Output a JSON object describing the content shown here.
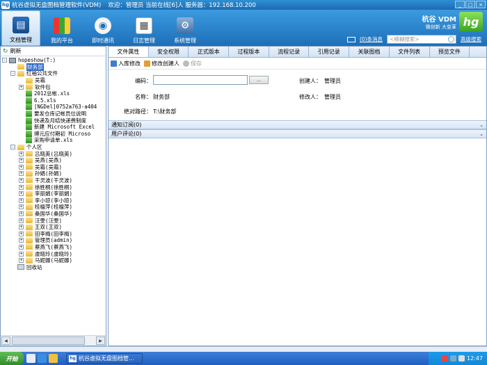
{
  "window": {
    "title": "杭谷虚拟无盘图档管理软件(VDM)",
    "welcome": "欢迎：管理员 当前在线[6]人 服务器：192.168.10.200"
  },
  "toolbar": {
    "tools": [
      {
        "label": "文档管理",
        "icon": "document-icon"
      },
      {
        "label": "我的平台",
        "icon": "books-icon"
      },
      {
        "label": "即时通讯",
        "icon": "chat-icon"
      },
      {
        "label": "日志管理",
        "icon": "log-icon"
      },
      {
        "label": "系统管理",
        "icon": "system-icon"
      }
    ],
    "messages_link": "(0)条消息",
    "search_placeholder": "<模糊搜索>",
    "advanced_search": "高级搜索"
  },
  "brand": {
    "name": "杭谷 VDM",
    "slogan": "微创新 大变革",
    "logo": "hg"
  },
  "sidebar": {
    "refresh_label": "刷新",
    "tree": [
      {
        "label": "hopeshow(T:)",
        "depth": 0,
        "type": "drive",
        "expander": "-"
      },
      {
        "label": "财务部",
        "depth": 1,
        "type": "folder",
        "selected": true
      },
      {
        "label": "红袖公共文件",
        "depth": 1,
        "type": "folder",
        "expander": "-"
      },
      {
        "label": "吴霜",
        "depth": 2,
        "type": "folder"
      },
      {
        "label": "软件包",
        "depth": 2,
        "type": "folder",
        "expander": "+"
      },
      {
        "label": "2012总帐.xls",
        "depth": 2,
        "type": "xls"
      },
      {
        "label": "6.5.xls",
        "depth": 2,
        "type": "xls"
      },
      {
        "label": "[NGDel]0752a763-a404",
        "depth": 2,
        "type": "xls"
      },
      {
        "label": "要发仓库记帐员位说明",
        "depth": 2,
        "type": "xls"
      },
      {
        "label": "快递及月结快递费制度",
        "depth": 2,
        "type": "xls"
      },
      {
        "label": "新建 Microsoft Excel",
        "depth": 2,
        "type": "xls"
      },
      {
        "label": "搏元应付期初 Microso",
        "depth": 2,
        "type": "xls"
      },
      {
        "label": "采购申请单.xls",
        "depth": 2,
        "type": "xls"
      },
      {
        "label": "个人区",
        "depth": 1,
        "type": "folder",
        "expander": "-"
      },
      {
        "label": "吕晓英(吕晓英)",
        "depth": 2,
        "type": "folder",
        "expander": "+"
      },
      {
        "label": "吴燕(吴燕)",
        "depth": 2,
        "type": "folder",
        "expander": "+"
      },
      {
        "label": "吴霜(吴霜)",
        "depth": 2,
        "type": "folder",
        "expander": "+"
      },
      {
        "label": "孙娟(孙娟)",
        "depth": 2,
        "type": "folder",
        "expander": "+"
      },
      {
        "label": "干灵波(干灵波)",
        "depth": 2,
        "type": "folder",
        "expander": "+"
      },
      {
        "label": "徐胜桐(徐胜桐)",
        "depth": 2,
        "type": "folder",
        "expander": "+"
      },
      {
        "label": "李丽娟(李丽娟)",
        "depth": 2,
        "type": "folder",
        "expander": "+"
      },
      {
        "label": "李小琼(李小琼)",
        "depth": 2,
        "type": "folder",
        "expander": "+"
      },
      {
        "label": "桂檀萍(桂檀萍)",
        "depth": 2,
        "type": "folder",
        "expander": "+"
      },
      {
        "label": "桑国华(桑国华)",
        "depth": 2,
        "type": "folder",
        "expander": "+"
      },
      {
        "label": "汪雯(汪雯)",
        "depth": 2,
        "type": "folder",
        "expander": "+"
      },
      {
        "label": "王双(王双)",
        "depth": 2,
        "type": "folder",
        "expander": "+"
      },
      {
        "label": "田李梅(田李梅)",
        "depth": 2,
        "type": "folder",
        "expander": "+"
      },
      {
        "label": "管理员(admin)",
        "depth": 2,
        "type": "folder",
        "expander": "+"
      },
      {
        "label": "蔡燕飞(蔡燕飞)",
        "depth": 2,
        "type": "folder",
        "expander": "+"
      },
      {
        "label": "虞晓玲(虞晓玲)",
        "depth": 2,
        "type": "folder",
        "expander": "+"
      },
      {
        "label": "马妮娜(马妮娜)",
        "depth": 2,
        "type": "folder",
        "expander": "+"
      },
      {
        "label": "回收站",
        "depth": 1,
        "type": "trash"
      }
    ]
  },
  "main": {
    "tabs": [
      "文件属性",
      "安全权限",
      "正式版本",
      "过程版本",
      "流程记录",
      "引用记录",
      "关联图档",
      "文件列表",
      "预览文件"
    ],
    "actions": [
      {
        "label": "入库修改",
        "disabled": false
      },
      {
        "label": "修改创建人",
        "disabled": false
      },
      {
        "label": "保存",
        "disabled": true
      }
    ],
    "form": {
      "code_label": "编码：",
      "browse_label": "...",
      "creator_label": "创建人：",
      "creator_value": "管理员",
      "name_label": "名称：",
      "name_value": "财务部",
      "modifier_label": "修改人：",
      "modifier_value": "管理员",
      "path_label": "绝对路径：",
      "path_value": "T:\\财务部"
    },
    "sections": [
      {
        "label": "通知订阅(0)"
      },
      {
        "label": "用户评论(0)"
      }
    ]
  },
  "taskbar": {
    "start": "开始",
    "task": "杭谷虚拟无盘图档管...",
    "clock": "12:47"
  },
  "colors": {
    "accent": "#1d6fb8",
    "brand_green": "#3ba522",
    "selection": "#316ac5"
  }
}
